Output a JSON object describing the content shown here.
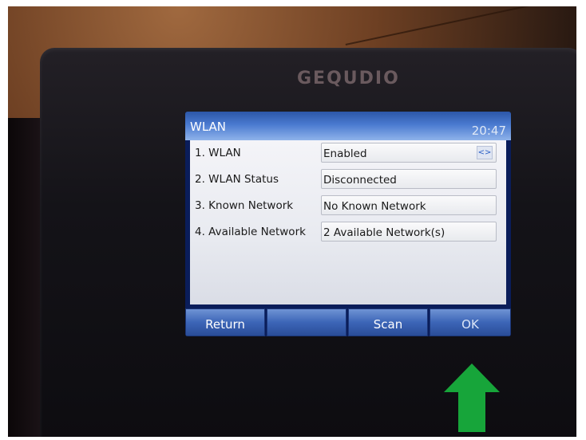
{
  "device": {
    "brand": "GEQUDIO"
  },
  "screen": {
    "title": "WLAN",
    "clock": "20:47",
    "rows": [
      {
        "label": "1. WLAN",
        "value": "Enabled",
        "has_arrows": true
      },
      {
        "label": "2. WLAN Status",
        "value": "Disconnected"
      },
      {
        "label": "3. Known Network",
        "value": "No Known Network"
      },
      {
        "label": "4. Available Network",
        "value": "2 Available Network(s)"
      }
    ],
    "arrows_glyph": "<>",
    "softkeys": [
      "Return",
      "",
      "Scan",
      "OK"
    ]
  },
  "overlay": {
    "arrow_color": "#17a53a",
    "arrow_icon": "up-arrow-icon"
  }
}
